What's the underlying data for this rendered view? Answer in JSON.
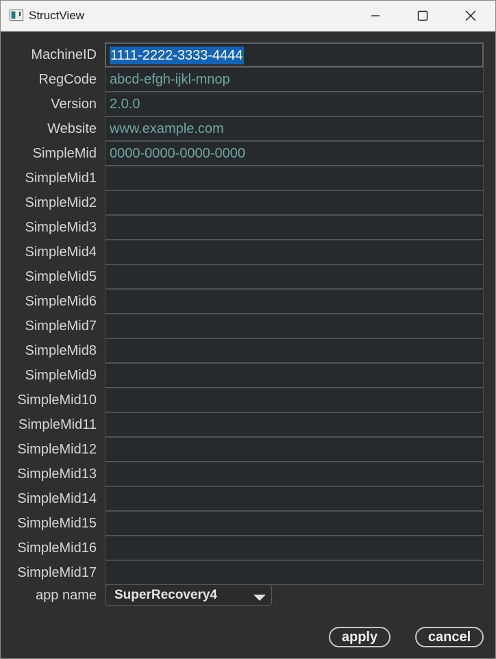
{
  "window": {
    "title": "StructView",
    "app_icon": "structview-app-icon"
  },
  "title_buttons": {
    "minimize_icon": "minimize-icon",
    "maximize_icon": "maximize-icon",
    "close_icon": "close-icon"
  },
  "form": {
    "rows": [
      {
        "label": "MachineID",
        "value": "1111-2222-3333-4444",
        "selected": true
      },
      {
        "label": "RegCode",
        "value": "abcd-efgh-ijkl-mnop"
      },
      {
        "label": "Version",
        "value": "2.0.0"
      },
      {
        "label": "Website",
        "value": "www.example.com"
      },
      {
        "label": "SimpleMid",
        "value": "0000-0000-0000-0000"
      },
      {
        "label": "SimpleMid1",
        "value": ""
      },
      {
        "label": "SimpleMid2",
        "value": ""
      },
      {
        "label": "SimpleMid3",
        "value": ""
      },
      {
        "label": "SimpleMid4",
        "value": ""
      },
      {
        "label": "SimpleMid5",
        "value": ""
      },
      {
        "label": "SimpleMid6",
        "value": ""
      },
      {
        "label": "SimpleMid7",
        "value": ""
      },
      {
        "label": "SimpleMid8",
        "value": ""
      },
      {
        "label": "SimpleMid9",
        "value": ""
      },
      {
        "label": "SimpleMid10",
        "value": ""
      },
      {
        "label": "SimpleMid11",
        "value": ""
      },
      {
        "label": "SimpleMid12",
        "value": ""
      },
      {
        "label": "SimpleMid13",
        "value": ""
      },
      {
        "label": "SimpleMid14",
        "value": ""
      },
      {
        "label": "SimpleMid15",
        "value": ""
      },
      {
        "label": "SimpleMid16",
        "value": ""
      },
      {
        "label": "SimpleMid17",
        "value": ""
      }
    ],
    "app_name": {
      "label": "app name",
      "selected": "SuperRecovery4",
      "arrow_icon": "dropdown-arrow-icon"
    }
  },
  "buttons": {
    "apply": "apply",
    "cancel": "cancel"
  },
  "colors": {
    "window_bg": "#2f2f2f",
    "field_bg": "#272a2d",
    "field_text": "#6fa6a0",
    "selection": "#1663b4",
    "label_text": "#d6d6d6"
  }
}
